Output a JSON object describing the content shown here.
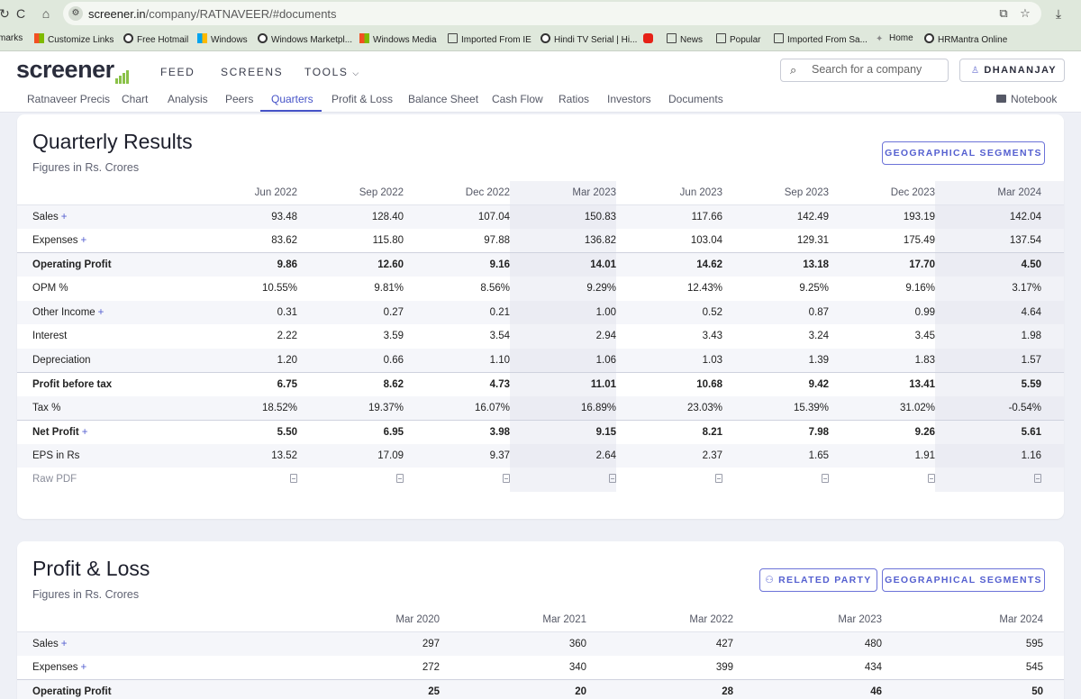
{
  "browser": {
    "url_domain": "screener.in",
    "url_path": "/company/RATNAVEER/#documents",
    "bookmarks": [
      "marks",
      "Customize Links",
      "Free Hotmail",
      "Windows",
      "Windows Marketpl...",
      "Windows Media",
      "Imported From IE",
      "Hindi TV Serial | Hi...",
      "",
      "News",
      "Popular",
      "Imported From Sa...",
      "Home",
      "HRMantra Online"
    ]
  },
  "header": {
    "logo": "screener",
    "nav": [
      "FEED",
      "SCREENS",
      "TOOLS"
    ],
    "search_placeholder": "Search for a company",
    "user": "DHANANJAY"
  },
  "subnav": {
    "tabs": [
      "Ratnaveer Precis",
      "Chart",
      "Analysis",
      "Peers",
      "Quarters",
      "Profit & Loss",
      "Balance Sheet",
      "Cash Flow",
      "Ratios",
      "Investors",
      "Documents"
    ],
    "active": "Quarters",
    "notebook": "Notebook"
  },
  "quarterly": {
    "title": "Quarterly Results",
    "subtitle": "Figures in Rs. Crores",
    "button": "GEOGRAPHICAL SEGMENTS",
    "columns": [
      "Jun 2022",
      "Sep 2022",
      "Dec 2022",
      "Mar 2023",
      "Jun 2023",
      "Sep 2023",
      "Dec 2023",
      "Mar 2024"
    ],
    "rows": [
      {
        "label": "Sales",
        "plus": "+",
        "values": [
          "93.48",
          "128.40",
          "107.04",
          "150.83",
          "117.66",
          "142.49",
          "193.19",
          "142.04"
        ]
      },
      {
        "label": "Expenses",
        "plus": "+",
        "values": [
          "83.62",
          "115.80",
          "97.88",
          "136.82",
          "103.04",
          "129.31",
          "175.49",
          "137.54"
        ]
      },
      {
        "label": "Operating Profit",
        "plus": "",
        "values": [
          "9.86",
          "12.60",
          "9.16",
          "14.01",
          "14.62",
          "13.18",
          "17.70",
          "4.50"
        ]
      },
      {
        "label": "OPM %",
        "plus": "",
        "values": [
          "10.55%",
          "9.81%",
          "8.56%",
          "9.29%",
          "12.43%",
          "9.25%",
          "9.16%",
          "3.17%"
        ]
      },
      {
        "label": "Other Income",
        "plus": "+",
        "values": [
          "0.31",
          "0.27",
          "0.21",
          "1.00",
          "0.52",
          "0.87",
          "0.99",
          "4.64"
        ]
      },
      {
        "label": "Interest",
        "plus": "",
        "values": [
          "2.22",
          "3.59",
          "3.54",
          "2.94",
          "3.43",
          "3.24",
          "3.45",
          "1.98"
        ]
      },
      {
        "label": "Depreciation",
        "plus": "",
        "values": [
          "1.20",
          "0.66",
          "1.10",
          "1.06",
          "1.03",
          "1.39",
          "1.83",
          "1.57"
        ]
      },
      {
        "label": "Profit before tax",
        "plus": "",
        "values": [
          "6.75",
          "8.62",
          "4.73",
          "11.01",
          "10.68",
          "9.42",
          "13.41",
          "5.59"
        ]
      },
      {
        "label": "Tax %",
        "plus": "",
        "values": [
          "18.52%",
          "19.37%",
          "16.07%",
          "16.89%",
          "23.03%",
          "15.39%",
          "31.02%",
          "-0.54%"
        ]
      },
      {
        "label": "Net Profit",
        "plus": "+",
        "values": [
          "5.50",
          "6.95",
          "3.98",
          "9.15",
          "8.21",
          "7.98",
          "9.26",
          "5.61"
        ]
      },
      {
        "label": "EPS in Rs",
        "plus": "",
        "values": [
          "13.52",
          "17.09",
          "9.37",
          "2.64",
          "2.37",
          "1.65",
          "1.91",
          "1.16"
        ]
      }
    ],
    "raw_pdf": "Raw PDF"
  },
  "profit_loss": {
    "title": "Profit & Loss",
    "subtitle": "Figures in Rs. Crores",
    "button_related": "RELATED PARTY",
    "button_geo": "GEOGRAPHICAL SEGMENTS",
    "columns": [
      "Mar 2020",
      "Mar 2021",
      "Mar 2022",
      "Mar 2023",
      "Mar 2024"
    ],
    "rows": [
      {
        "label": "Sales",
        "plus": "+",
        "values": [
          "297",
          "360",
          "427",
          "480",
          "595"
        ]
      },
      {
        "label": "Expenses",
        "plus": "+",
        "values": [
          "272",
          "340",
          "399",
          "434",
          "545"
        ]
      },
      {
        "label": "Operating Profit",
        "plus": "",
        "values": [
          "25",
          "20",
          "28",
          "46",
          "50"
        ]
      }
    ]
  },
  "colors": {
    "accent": "#4653c8",
    "logo_bars": "#8ac148",
    "chrome": "#dfe8dc",
    "page_bg": "#eef0f6"
  }
}
